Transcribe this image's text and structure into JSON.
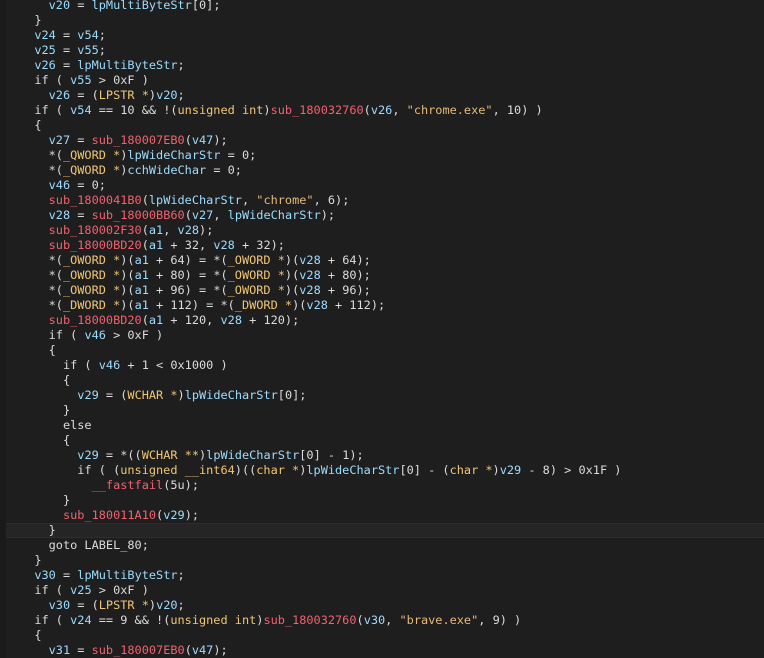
{
  "editor": {
    "lines": [
      [
        [
          "    ",
          "plain"
        ],
        [
          "v20",
          "var"
        ],
        [
          " = ",
          "plain"
        ],
        [
          "lpMultiByteStr",
          "var"
        ],
        [
          "[0];",
          "plain"
        ]
      ],
      [
        [
          "  }",
          "plain"
        ]
      ],
      [
        [
          "  ",
          "plain"
        ],
        [
          "v24",
          "var"
        ],
        [
          " = ",
          "plain"
        ],
        [
          "v54",
          "var"
        ],
        [
          ";",
          "plain"
        ]
      ],
      [
        [
          "  ",
          "plain"
        ],
        [
          "v25",
          "var"
        ],
        [
          " = ",
          "plain"
        ],
        [
          "v55",
          "var"
        ],
        [
          ";",
          "plain"
        ]
      ],
      [
        [
          "  ",
          "plain"
        ],
        [
          "v26",
          "var"
        ],
        [
          " = ",
          "plain"
        ],
        [
          "lpMultiByteStr",
          "var"
        ],
        [
          ";",
          "plain"
        ]
      ],
      [
        [
          "  if ( ",
          "plain"
        ],
        [
          "v55",
          "var"
        ],
        [
          " > 0xF )",
          "plain"
        ]
      ],
      [
        [
          "    ",
          "plain"
        ],
        [
          "v26",
          "var"
        ],
        [
          " = (",
          "plain"
        ],
        [
          "LPSTR *",
          "type"
        ],
        [
          ")",
          "plain"
        ],
        [
          "v20",
          "var"
        ],
        [
          ";",
          "plain"
        ]
      ],
      [
        [
          "  if ( ",
          "plain"
        ],
        [
          "v54",
          "var"
        ],
        [
          " == 10 && !(",
          "plain"
        ],
        [
          "unsigned int",
          "type"
        ],
        [
          ")",
          "plain"
        ],
        [
          "sub_180032760",
          "func"
        ],
        [
          "(",
          "plain"
        ],
        [
          "v26",
          "var"
        ],
        [
          ", ",
          "plain"
        ],
        [
          "\"chrome.exe\"",
          "str"
        ],
        [
          ", 10) )",
          "plain"
        ]
      ],
      [
        [
          "  {",
          "plain"
        ]
      ],
      [
        [
          "    ",
          "plain"
        ],
        [
          "v27",
          "var"
        ],
        [
          " = ",
          "plain"
        ],
        [
          "sub_180007EB0",
          "func"
        ],
        [
          "(",
          "plain"
        ],
        [
          "v47",
          "var"
        ],
        [
          ");",
          "plain"
        ]
      ],
      [
        [
          "    *(",
          "plain"
        ],
        [
          "_QWORD *",
          "type"
        ],
        [
          ")",
          "plain"
        ],
        [
          "lpWideCharStr",
          "var"
        ],
        [
          " = 0;",
          "plain"
        ]
      ],
      [
        [
          "    *(",
          "plain"
        ],
        [
          "_QWORD *",
          "type"
        ],
        [
          ")",
          "plain"
        ],
        [
          "cchWideChar",
          "var"
        ],
        [
          " = 0;",
          "plain"
        ]
      ],
      [
        [
          "    ",
          "plain"
        ],
        [
          "v46",
          "var"
        ],
        [
          " = 0;",
          "plain"
        ]
      ],
      [
        [
          "    ",
          "plain"
        ],
        [
          "sub_1800041B0",
          "func"
        ],
        [
          "(",
          "plain"
        ],
        [
          "lpWideCharStr",
          "var"
        ],
        [
          ", ",
          "plain"
        ],
        [
          "\"chrome\"",
          "str"
        ],
        [
          ", 6);",
          "plain"
        ]
      ],
      [
        [
          "    ",
          "plain"
        ],
        [
          "v28",
          "var"
        ],
        [
          " = ",
          "plain"
        ],
        [
          "sub_18000BB60",
          "func"
        ],
        [
          "(",
          "plain"
        ],
        [
          "v27",
          "var"
        ],
        [
          ", ",
          "plain"
        ],
        [
          "lpWideCharStr",
          "var"
        ],
        [
          ");",
          "plain"
        ]
      ],
      [
        [
          "    ",
          "plain"
        ],
        [
          "sub_180002F30",
          "func"
        ],
        [
          "(",
          "plain"
        ],
        [
          "a1",
          "var"
        ],
        [
          ", ",
          "plain"
        ],
        [
          "v28",
          "var"
        ],
        [
          ");",
          "plain"
        ]
      ],
      [
        [
          "    ",
          "plain"
        ],
        [
          "sub_18000BD20",
          "func"
        ],
        [
          "(",
          "plain"
        ],
        [
          "a1",
          "var"
        ],
        [
          " + 32, ",
          "plain"
        ],
        [
          "v28",
          "var"
        ],
        [
          " + 32);",
          "plain"
        ]
      ],
      [
        [
          "    *(",
          "plain"
        ],
        [
          "_OWORD *",
          "type"
        ],
        [
          ")(",
          "plain"
        ],
        [
          "a1",
          "var"
        ],
        [
          " + 64) = *(",
          "plain"
        ],
        [
          "_OWORD *",
          "type"
        ],
        [
          ")(",
          "plain"
        ],
        [
          "v28",
          "var"
        ],
        [
          " + 64);",
          "plain"
        ]
      ],
      [
        [
          "    *(",
          "plain"
        ],
        [
          "_OWORD *",
          "type"
        ],
        [
          ")(",
          "plain"
        ],
        [
          "a1",
          "var"
        ],
        [
          " + 80) = *(",
          "plain"
        ],
        [
          "_OWORD *",
          "type"
        ],
        [
          ")(",
          "plain"
        ],
        [
          "v28",
          "var"
        ],
        [
          " + 80);",
          "plain"
        ]
      ],
      [
        [
          "    *(",
          "plain"
        ],
        [
          "_OWORD *",
          "type"
        ],
        [
          ")(",
          "plain"
        ],
        [
          "a1",
          "var"
        ],
        [
          " + 96) = *(",
          "plain"
        ],
        [
          "_OWORD *",
          "type"
        ],
        [
          ")(",
          "plain"
        ],
        [
          "v28",
          "var"
        ],
        [
          " + 96);",
          "plain"
        ]
      ],
      [
        [
          "    *(",
          "plain"
        ],
        [
          "_DWORD *",
          "type"
        ],
        [
          ")(",
          "plain"
        ],
        [
          "a1",
          "var"
        ],
        [
          " + 112) = *(",
          "plain"
        ],
        [
          "_DWORD *",
          "type"
        ],
        [
          ")(",
          "plain"
        ],
        [
          "v28",
          "var"
        ],
        [
          " + 112);",
          "plain"
        ]
      ],
      [
        [
          "    ",
          "plain"
        ],
        [
          "sub_18000BD20",
          "func"
        ],
        [
          "(",
          "plain"
        ],
        [
          "a1",
          "var"
        ],
        [
          " + 120, ",
          "plain"
        ],
        [
          "v28",
          "var"
        ],
        [
          " + 120);",
          "plain"
        ]
      ],
      [
        [
          "    if ( ",
          "plain"
        ],
        [
          "v46",
          "var"
        ],
        [
          " > 0xF )",
          "plain"
        ]
      ],
      [
        [
          "    {",
          "plain"
        ]
      ],
      [
        [
          "      if ( ",
          "plain"
        ],
        [
          "v46",
          "var"
        ],
        [
          " + 1 < 0x1000 )",
          "plain"
        ]
      ],
      [
        [
          "      {",
          "plain"
        ]
      ],
      [
        [
          "        ",
          "plain"
        ],
        [
          "v29",
          "var"
        ],
        [
          " = (",
          "plain"
        ],
        [
          "WCHAR *",
          "type"
        ],
        [
          ")",
          "plain"
        ],
        [
          "lpWideCharStr",
          "var"
        ],
        [
          "[0];",
          "plain"
        ]
      ],
      [
        [
          "      }",
          "plain"
        ]
      ],
      [
        [
          "      else",
          "plain"
        ]
      ],
      [
        [
          "      {",
          "plain"
        ]
      ],
      [
        [
          "        ",
          "plain"
        ],
        [
          "v29",
          "var"
        ],
        [
          " = *((",
          "plain"
        ],
        [
          "WCHAR **",
          "type"
        ],
        [
          ")",
          "plain"
        ],
        [
          "lpWideCharStr",
          "var"
        ],
        [
          "[0] - 1);",
          "plain"
        ]
      ],
      [
        [
          "        if ( (",
          "plain"
        ],
        [
          "unsigned __int64",
          "type"
        ],
        [
          ")((",
          "plain"
        ],
        [
          "char *",
          "type"
        ],
        [
          ")",
          "plain"
        ],
        [
          "lpWideCharStr",
          "var"
        ],
        [
          "[0] - (",
          "plain"
        ],
        [
          "char *",
          "type"
        ],
        [
          ")",
          "plain"
        ],
        [
          "v29",
          "var"
        ],
        [
          " - 8) > 0x1F )",
          "plain"
        ]
      ],
      [
        [
          "          ",
          "plain"
        ],
        [
          "__fastfail",
          "func"
        ],
        [
          "(5u);",
          "plain"
        ]
      ],
      [
        [
          "      }",
          "plain"
        ]
      ],
      [
        [
          "      ",
          "plain"
        ],
        [
          "sub_180011A10",
          "func"
        ],
        [
          "(",
          "plain"
        ],
        [
          "v29",
          "var"
        ],
        [
          ");",
          "plain"
        ]
      ],
      [
        [
          "    }",
          "plain"
        ]
      ],
      [
        [
          "    goto LABEL_80;",
          "plain"
        ]
      ],
      [
        [
          "  }",
          "plain"
        ]
      ],
      [
        [
          "  ",
          "plain"
        ],
        [
          "v30",
          "var"
        ],
        [
          " = ",
          "plain"
        ],
        [
          "lpMultiByteStr",
          "var"
        ],
        [
          ";",
          "plain"
        ]
      ],
      [
        [
          "  if ( ",
          "plain"
        ],
        [
          "v25",
          "var"
        ],
        [
          " > 0xF )",
          "plain"
        ]
      ],
      [
        [
          "    ",
          "plain"
        ],
        [
          "v30",
          "var"
        ],
        [
          " = (",
          "plain"
        ],
        [
          "LPSTR *",
          "type"
        ],
        [
          ")",
          "plain"
        ],
        [
          "v20",
          "var"
        ],
        [
          ";",
          "plain"
        ]
      ],
      [
        [
          "  if ( ",
          "plain"
        ],
        [
          "v24",
          "var"
        ],
        [
          " == 9 && !(",
          "plain"
        ],
        [
          "unsigned int",
          "type"
        ],
        [
          ")",
          "plain"
        ],
        [
          "sub_180032760",
          "func"
        ],
        [
          "(",
          "plain"
        ],
        [
          "v30",
          "var"
        ],
        [
          ", ",
          "plain"
        ],
        [
          "\"brave.exe\"",
          "str"
        ],
        [
          ", 9) )",
          "plain"
        ]
      ],
      [
        [
          "  {",
          "plain"
        ]
      ],
      [
        [
          "    ",
          "plain"
        ],
        [
          "v31",
          "var"
        ],
        [
          " = ",
          "plain"
        ],
        [
          "sub_180007EB0",
          "func"
        ],
        [
          "(",
          "plain"
        ],
        [
          "v47",
          "var"
        ],
        [
          ");",
          "plain"
        ]
      ]
    ],
    "current_line_index": 35
  },
  "theme": {
    "background": "#1e1e1e",
    "plain": "#dcdcdc",
    "var": "#9cdcfe",
    "func": "#f2616d",
    "type": "#f0c674",
    "str": "#e8b97b"
  }
}
